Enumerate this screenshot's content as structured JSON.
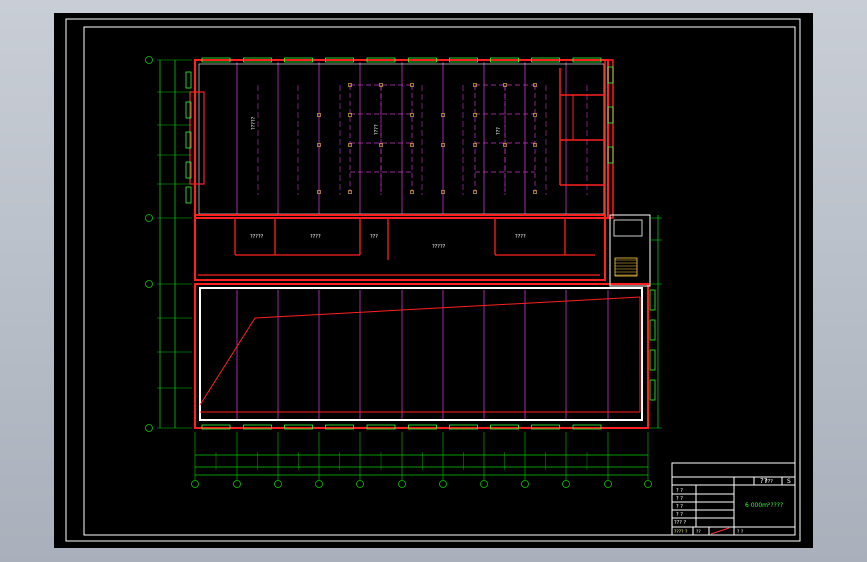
{
  "title_block": {
    "top_mark": "??",
    "top_label": "???",
    "top_num": "S",
    "area_text": "6 000m²????",
    "rows": [
      "? ?",
      "? ?",
      "? ?",
      "? ?",
      "??? ?"
    ],
    "bottom_cells": [
      "???? ?",
      "??",
      "? ?"
    ]
  },
  "room_labels": [
    "?????",
    "????",
    "???",
    "?????",
    "????"
  ],
  "colors": {
    "wall": "#ff2020",
    "grid": "#cc33cc",
    "dimension": "#00cc00",
    "window": "#33ff33",
    "column": "#ffcc44",
    "frame": "#ffffff"
  }
}
